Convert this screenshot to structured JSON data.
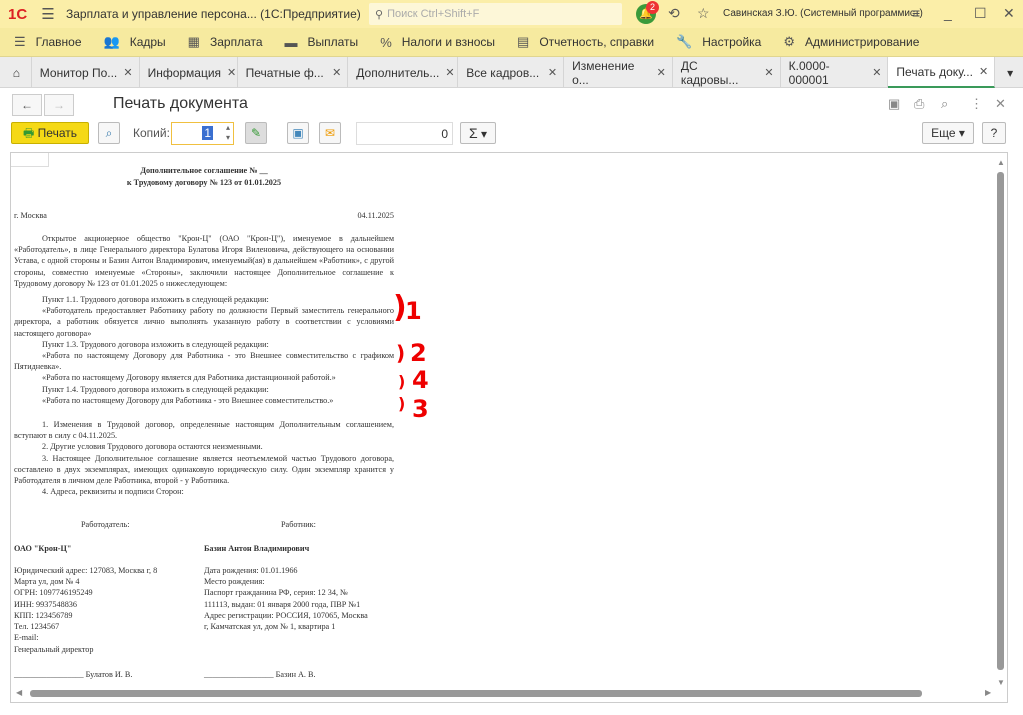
{
  "titlebar": {
    "logo": "1С",
    "title": "Зарплата и управление персона...  (1С:Предприятие)",
    "search_placeholder": "Поиск Ctrl+Shift+F",
    "notifications": "2",
    "user": "Савинская З.Ю. (Системный программист)"
  },
  "menu": [
    {
      "icon": "list-icon",
      "label": "Главное"
    },
    {
      "icon": "people-icon",
      "label": "Кадры"
    },
    {
      "icon": "calculator-icon",
      "label": "Зарплата"
    },
    {
      "icon": "wallet-icon",
      "label": "Выплаты"
    },
    {
      "icon": "percent-icon",
      "label": "Налоги и взносы"
    },
    {
      "icon": "reports-icon",
      "label": "Отчетность, справки"
    },
    {
      "icon": "wrench-icon",
      "label": "Настройка"
    },
    {
      "icon": "gear-icon",
      "label": "Администрирование"
    }
  ],
  "tabs": [
    {
      "label": "Монитор По..."
    },
    {
      "label": "Информация"
    },
    {
      "label": "Печатные ф..."
    },
    {
      "label": "Дополнитель..."
    },
    {
      "label": "Все кадров..."
    },
    {
      "label": "Изменение о..."
    },
    {
      "label": "ДС кадровы..."
    },
    {
      "label": "К.0000-000001"
    },
    {
      "label": "Печать доку..."
    }
  ],
  "form": {
    "title": "Печать документа",
    "print_label": "Печать",
    "copies_label": "Копий:",
    "copies_value": "1",
    "sum_value": "0",
    "sum_label": "Σ",
    "more_label": "Еще",
    "help_label": "?"
  },
  "doc": {
    "title1": "Дополнительное соглашение № __",
    "title2": "к Трудовому договору № 123 от 01.01.2025",
    "city": "г. Москва",
    "date": "04.11.2025",
    "intro": "Открытое акционерное общество \"Крон-Ц\" (ОАО \"Крон-Ц\"), именуемое в дальнейшем «Работодатель», в лице Генерального директора Булатова Игоря Виленовича, действующего на основании Устава, с одной стороны и Базин Антон Владимирович, именуемый(ая) в дальнейшем «Работник», с другой стороны, совместно именуемые «Стороны», заключили настоящее Дополнительное соглашение к Трудовому договору № 123 от 01.01.2025 о нижеследующем:",
    "p11": "Пункт 1.1. Трудового договора изложить в следующей редакции:",
    "p11text": "«Работодатель предоставляет Работнику работу по должности Первый заместитель генерального директора, а работник обязуется лично выполнять указанную работу в соответствии с условиями настоящего договора»",
    "p13": "Пункт 1.3. Трудового договора изложить в следующей редакции:",
    "p13text": "«Работа по настоящему Договору для Работника - это Внешнее совместительство с графиком Пятидневка».",
    "p13text2": "«Работа по настоящему Договору является для Работника дистанционной работой.»",
    "p14": "Пункт 1.4. Трудового договора изложить в следующей редакции:",
    "p14text": "«Работа по настоящему Договору для Работника - это Внешнее совместительство.»",
    "c1": "1. Изменения в Трудовой договор, определенные настоящим Дополнительным соглашением, вступают в силу с 04.11.2025.",
    "c2": "2. Другие условия Трудового договора остаются неизменными.",
    "c3": "3. Настоящее Дополнительное соглашение является неотъемлемой частью Трудового договора, составлено в двух экземплярах, имеющих одинаковую юридическую силу. Один экземпляр хранится у Работодателя в личном деле Работника, второй - у Работника.",
    "c4": "4. Адреса, реквизиты и подписи Сторон:",
    "employer_head": "Работодатель:",
    "employee_head": "Работник:",
    "employer_name": "ОАО \"Крон-Ц\"",
    "employer_lines": [
      "Юридический адрес: 127083, Москва г, 8",
      "Марта ул, дом № 4",
      "ОГРН: 1097746195249",
      "ИНН: 9937548836",
      "КПП: 123456789",
      "Тел. 1234567",
      "E-mail:"
    ],
    "employer_position": "Генеральный директор",
    "employer_sign": "_________________ Булатов И. В.",
    "employee_name": "Базин Антон Владимирович",
    "employee_lines": [
      "Дата рождения: 01.01.1966",
      "Место рождения:",
      "Паспорт гражданина РФ, серия: 12 34, №",
      "111113, выдан: 01 января 2000 года, ПВР №1",
      "Адрес регистрации: РОССИЯ, 107065, Москва",
      "г, Камчатская ул, дом № 1, квартира 1"
    ],
    "employee_sign": "_________________ Базин А. В."
  },
  "annotations": [
    "1",
    "2",
    "4",
    "3"
  ],
  "colors": {
    "titlebar": "#fbeea8",
    "menubar": "#f6ea9f",
    "print_button": "#f5d916",
    "annotation": "#e00000"
  }
}
